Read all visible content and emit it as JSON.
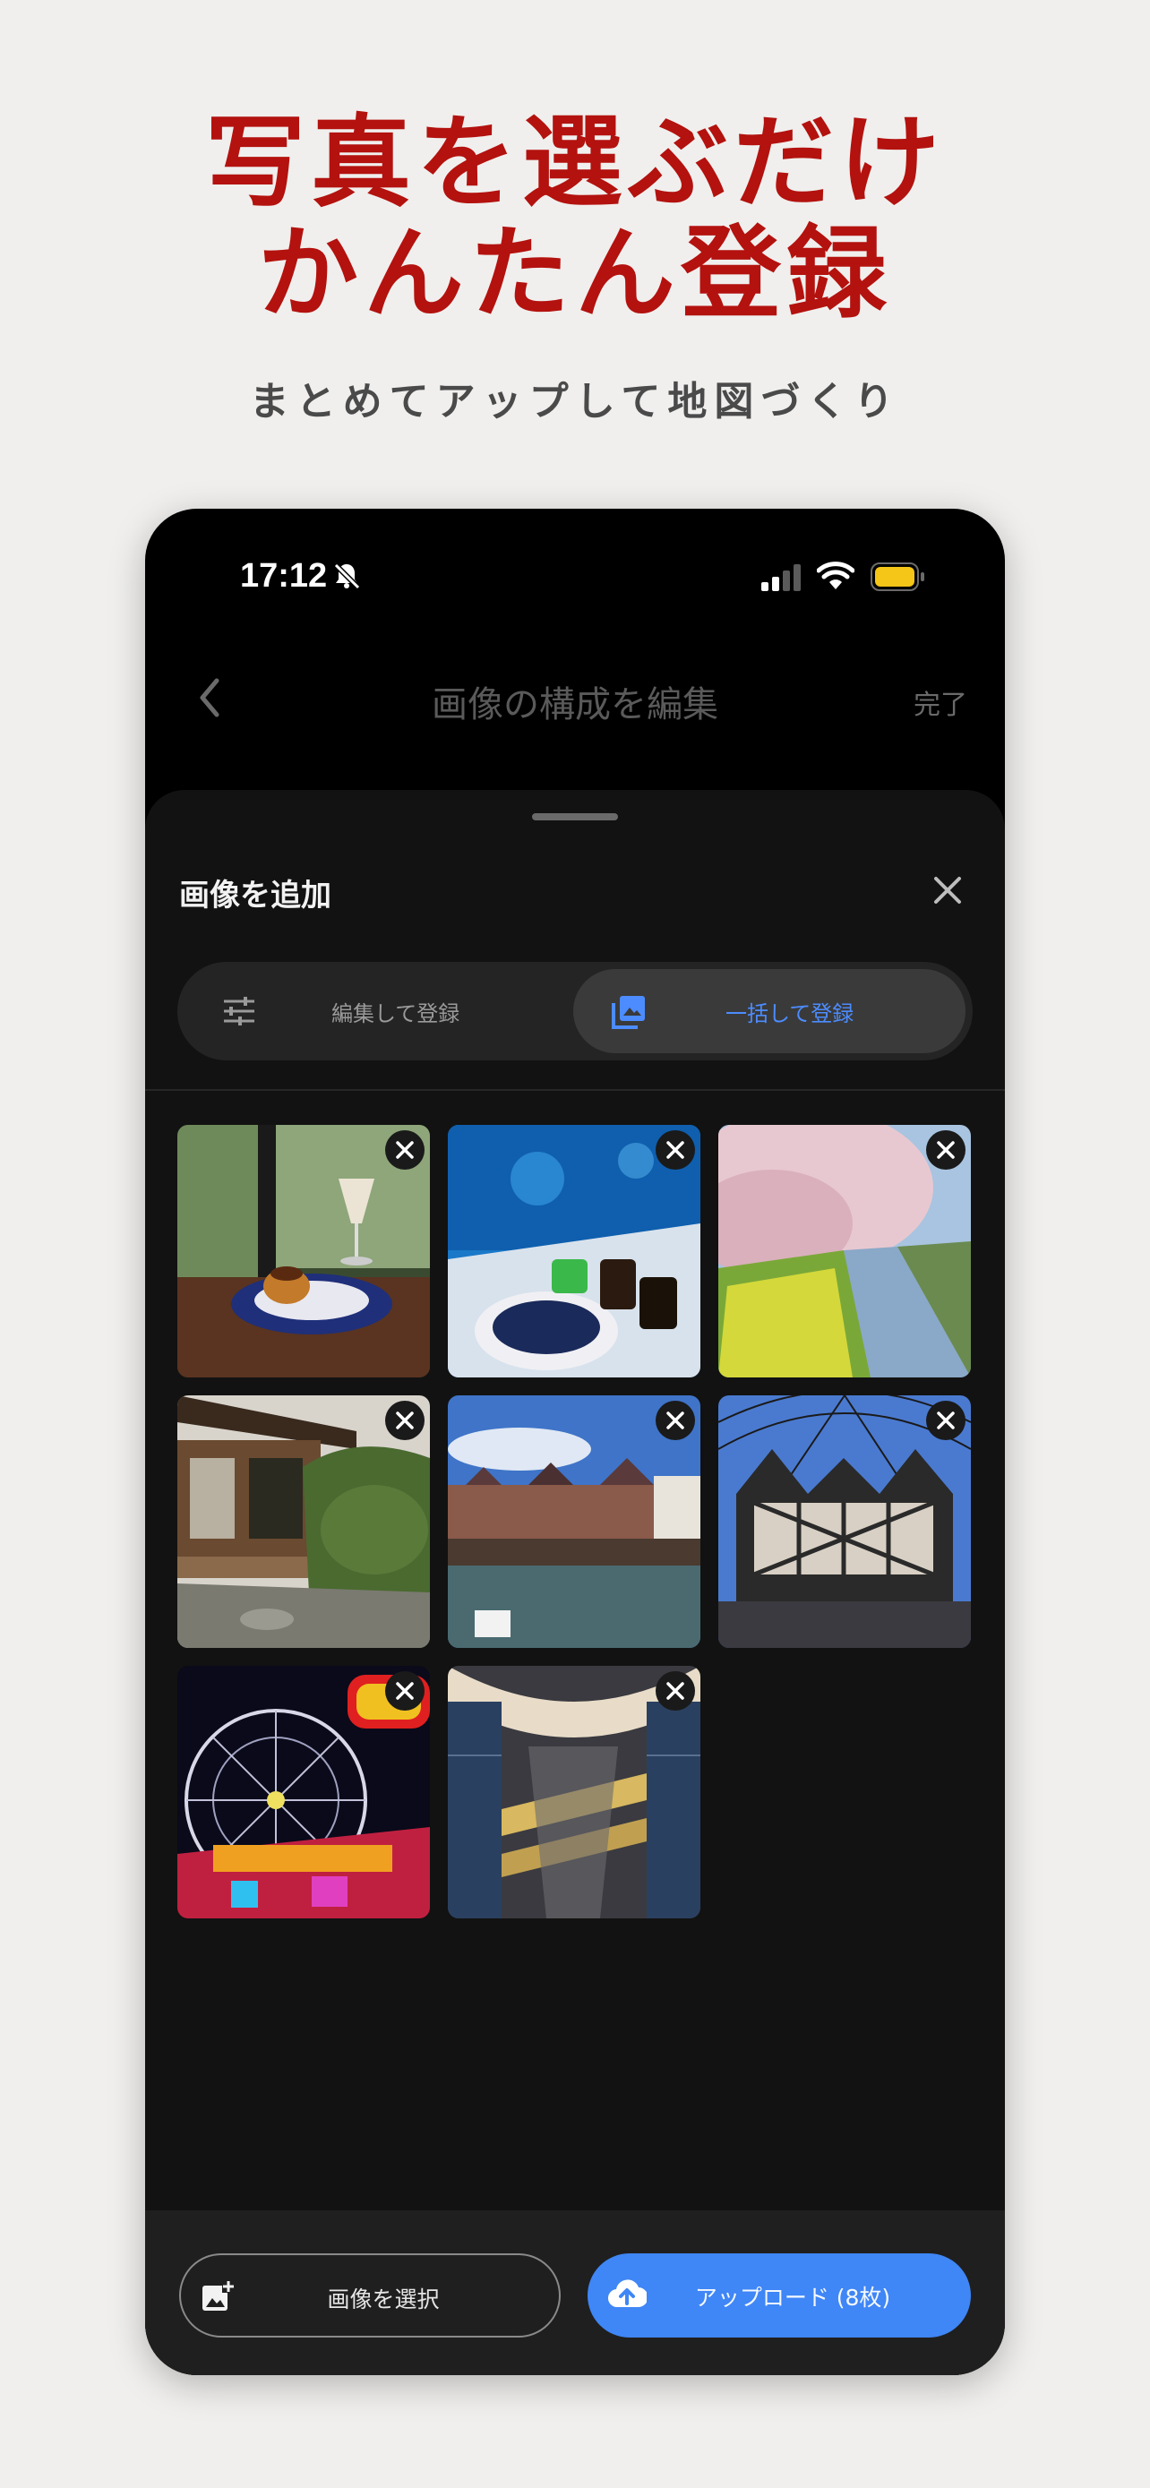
{
  "promo": {
    "headline_line1": "写真を選ぶだけ",
    "headline_line2": "かんたん登録",
    "subline": "まとめてアップして地図づくり"
  },
  "status_bar": {
    "time": "17:12"
  },
  "nav": {
    "title": "画像の構成を編集",
    "done_label": "完了"
  },
  "sheet": {
    "title": "画像を追加",
    "segments": [
      {
        "label": "編集して登録",
        "icon": "sliders-icon"
      },
      {
        "label": "一括して登録",
        "icon": "photo-library-icon",
        "selected": true
      }
    ],
    "photos": [
      {
        "name": "photo-pudding-dessert"
      },
      {
        "name": "photo-aquarium-drinks"
      },
      {
        "name": "photo-cherry-blossom-canal"
      },
      {
        "name": "photo-japanese-garden"
      },
      {
        "name": "photo-european-street"
      },
      {
        "name": "photo-tudor-building"
      },
      {
        "name": "photo-ferris-wheel-night"
      },
      {
        "name": "photo-glass-atrium"
      }
    ],
    "select_button": "画像を選択",
    "upload_button": "アップロード (8枚)"
  },
  "colors": {
    "headline": "#b3120f",
    "accent": "#3f86f6",
    "background": "#f0efed"
  }
}
